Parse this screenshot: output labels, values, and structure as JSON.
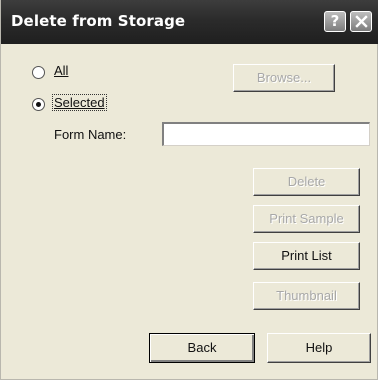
{
  "window": {
    "title": "Delete from Storage",
    "help_glyph": "?",
    "close_icon": "close-icon"
  },
  "scope": {
    "all_label": "All",
    "selected_label": "Selected",
    "selected_value": "Selected"
  },
  "form_name": {
    "label": "Form Name:",
    "value": ""
  },
  "buttons": {
    "browse": "Browse...",
    "delete": "Delete",
    "print_sample": "Print Sample",
    "print_list": "Print List",
    "thumbnail": "Thumbnail",
    "back": "Back",
    "help": "Help"
  },
  "colors": {
    "titlebar": "#2b2b2b",
    "dialog_face": "#ece9d8",
    "disabled_text": "#a8a8a8"
  }
}
